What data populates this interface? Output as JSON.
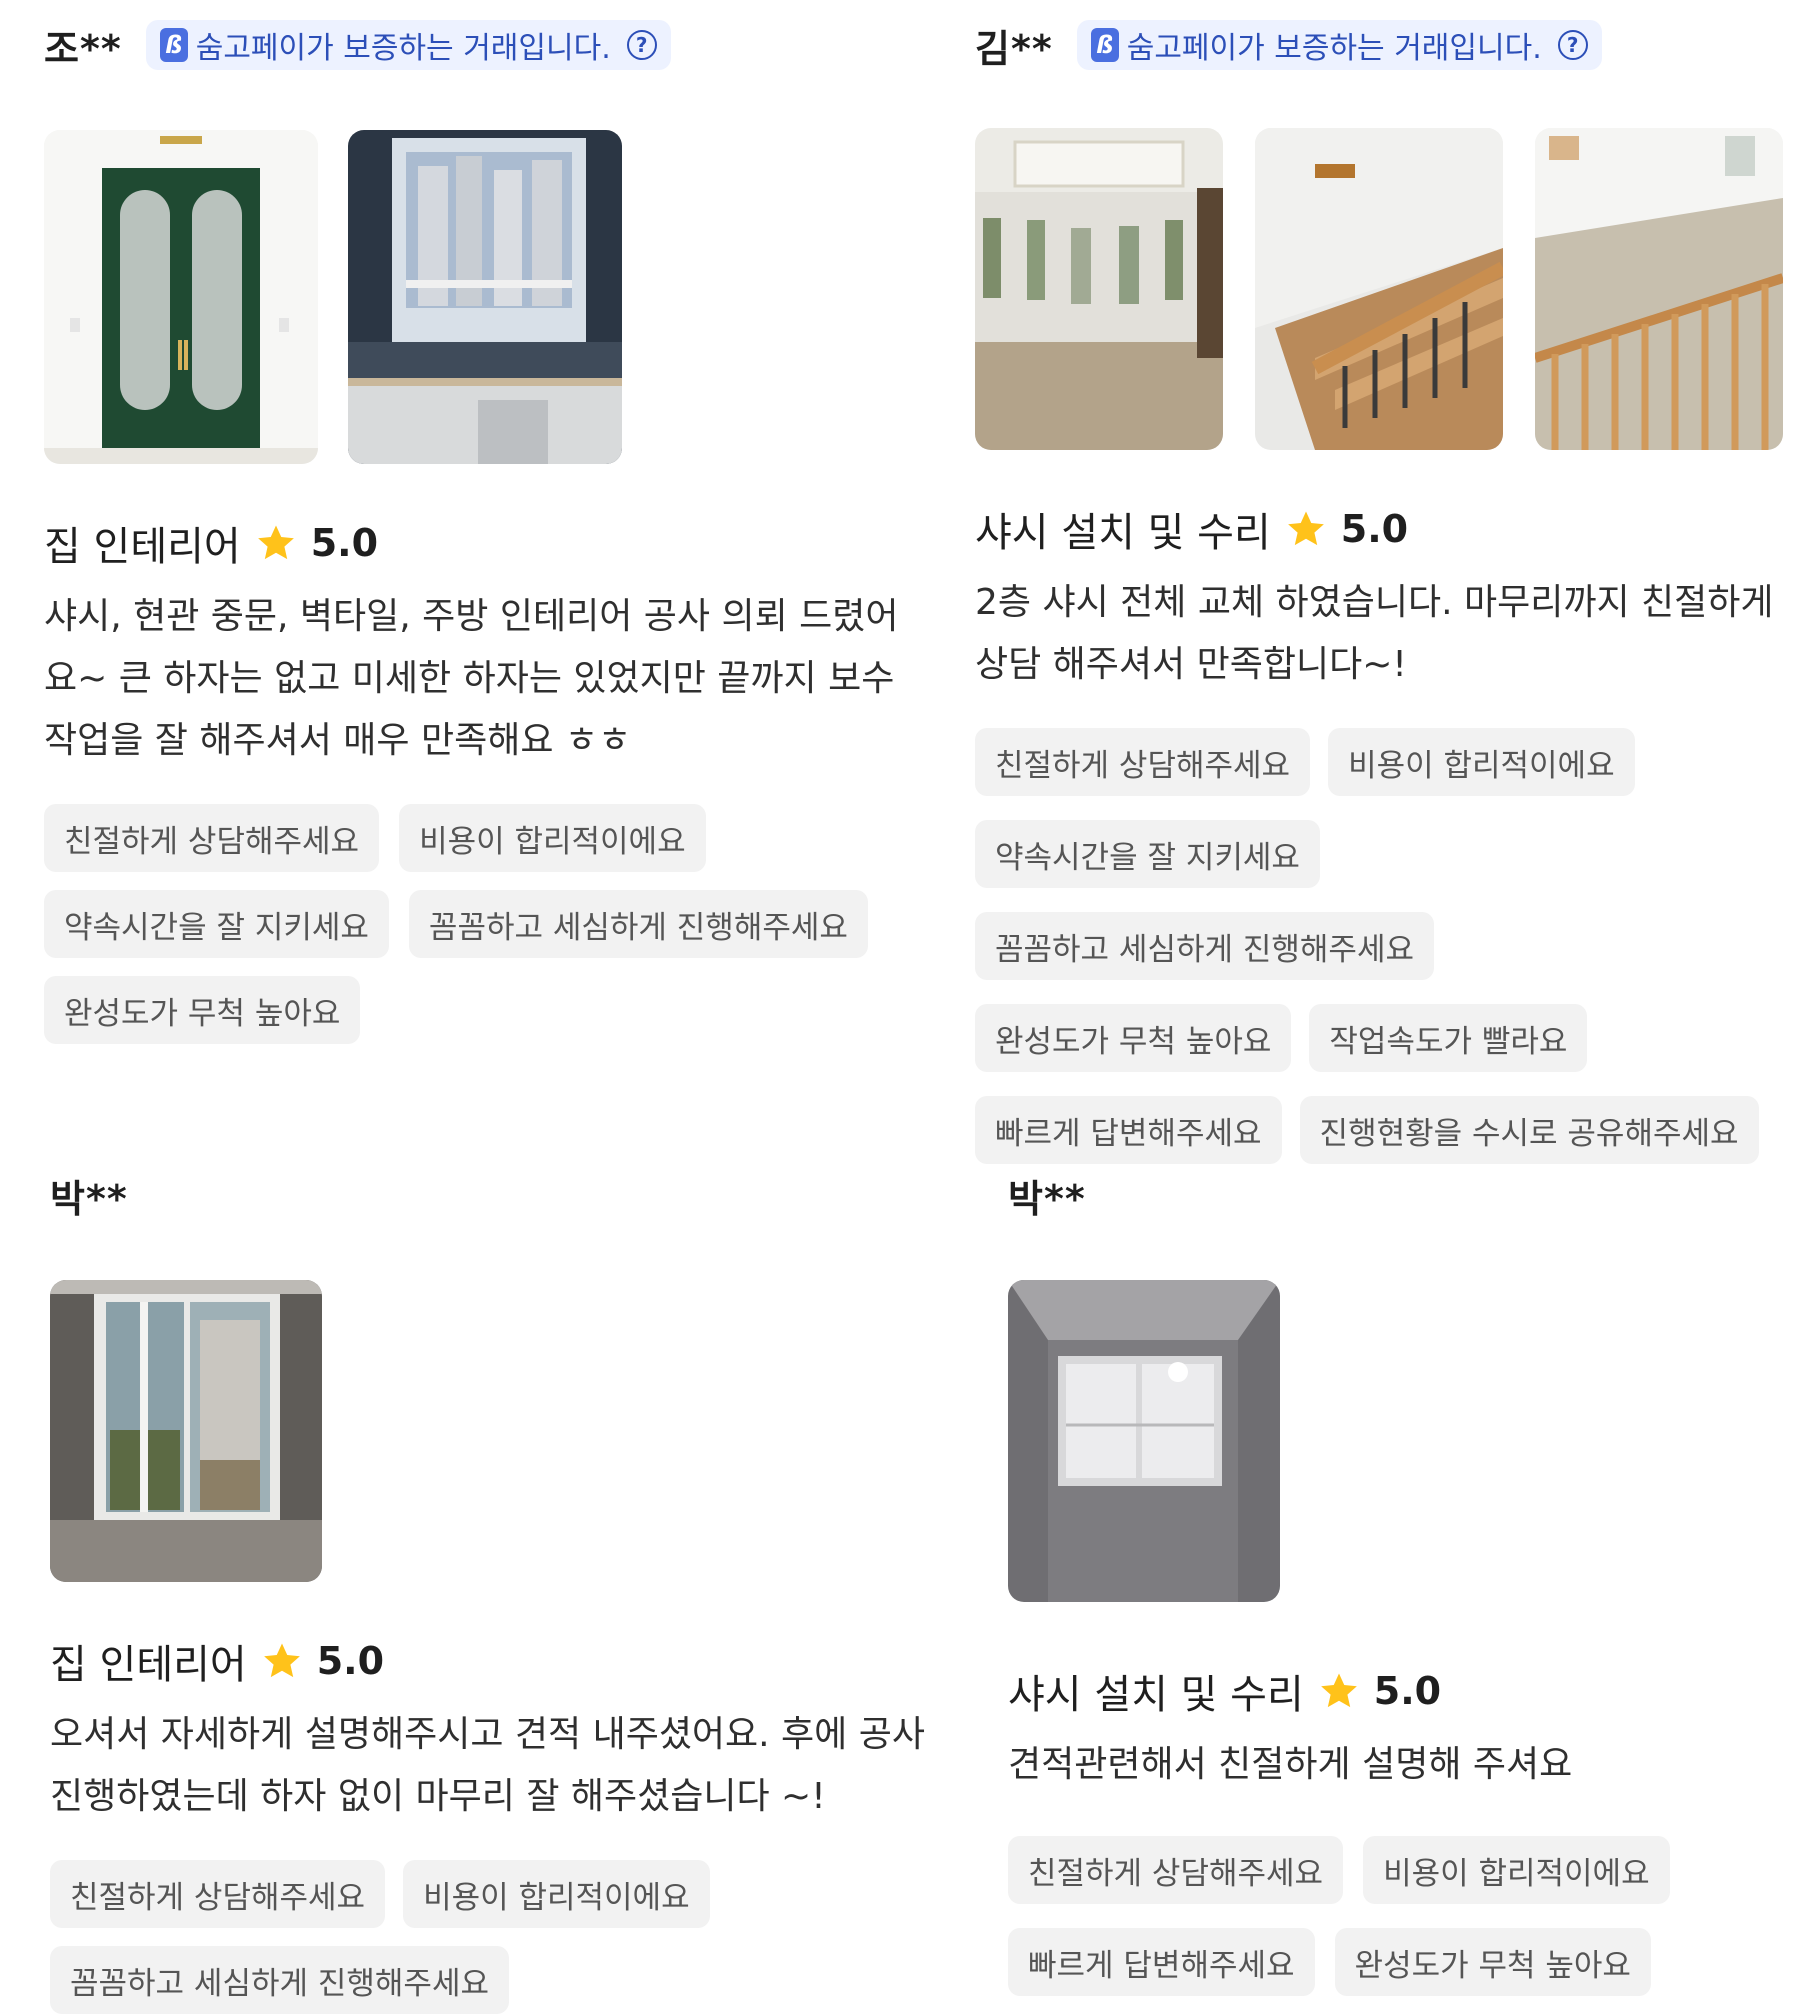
{
  "badge_text": "숨고페이가 보증하는 거래입니다.",
  "badge_icon": "soomgo-pay-icon",
  "help_icon_text": "?",
  "reviews": [
    {
      "author": "조**",
      "service": "집 인테리어",
      "rating": "5.0",
      "text": "샤시, 현관 중문, 벽타일, 주방 인테리어 공사 의뢰 드렸어요~ 큰 하자는 없고 미세한 하자는 있었지만 끝까지 보수작업을 잘 해주셔서 매우 만족해요 ㅎㅎ",
      "tags": [
        "친절하게 상담해주세요",
        "비용이 합리적이에요",
        "약속시간을 잘 지키세요",
        "꼼꼼하고 세심하게 진행해주세요",
        "완성도가 무척 높아요"
      ]
    },
    {
      "author": "김**",
      "service": "샤시 설치 및 수리",
      "rating": "5.0",
      "text": "2층 샤시 전체 교체 하였습니다. 마무리까지 친절하게 상담 해주셔서 만족합니다~!",
      "tags": [
        "친절하게 상담해주세요",
        "비용이 합리적이에요",
        "약속시간을 잘 지키세요",
        "꼼꼼하고 세심하게 진행해주세요",
        "완성도가 무척 높아요",
        "작업속도가 빨라요",
        "빠르게 답변해주세요",
        "진행현황을 수시로 공유해주세요"
      ]
    },
    {
      "author": "박**",
      "service": "집 인테리어",
      "rating": "5.0",
      "text": "오셔서 자세하게 설명해주시고 견적 내주셨어요. 후에 공사 진행하였는데 하자 없이 마무리 잘 해주셨습니다 ~!",
      "tags": [
        "친절하게 상담해주세요",
        "비용이 합리적이에요",
        "꼼꼼하고 세심하게 진행해주세요"
      ]
    },
    {
      "author": "박**",
      "service": "샤시 설치 및 수리",
      "rating": "5.0",
      "text": "견적관련해서 친절하게 설명해 주셔요",
      "tags": [
        "친절하게 상담해주세요",
        "비용이 합리적이에요",
        "빠르게 답변해주세요",
        "완성도가 무척 높아요"
      ]
    }
  ],
  "colors": {
    "badge_bg": "#edf2ff",
    "badge_text": "#2c4fb8",
    "star": "#ffc21a",
    "tag_bg": "#f2f2f2"
  }
}
